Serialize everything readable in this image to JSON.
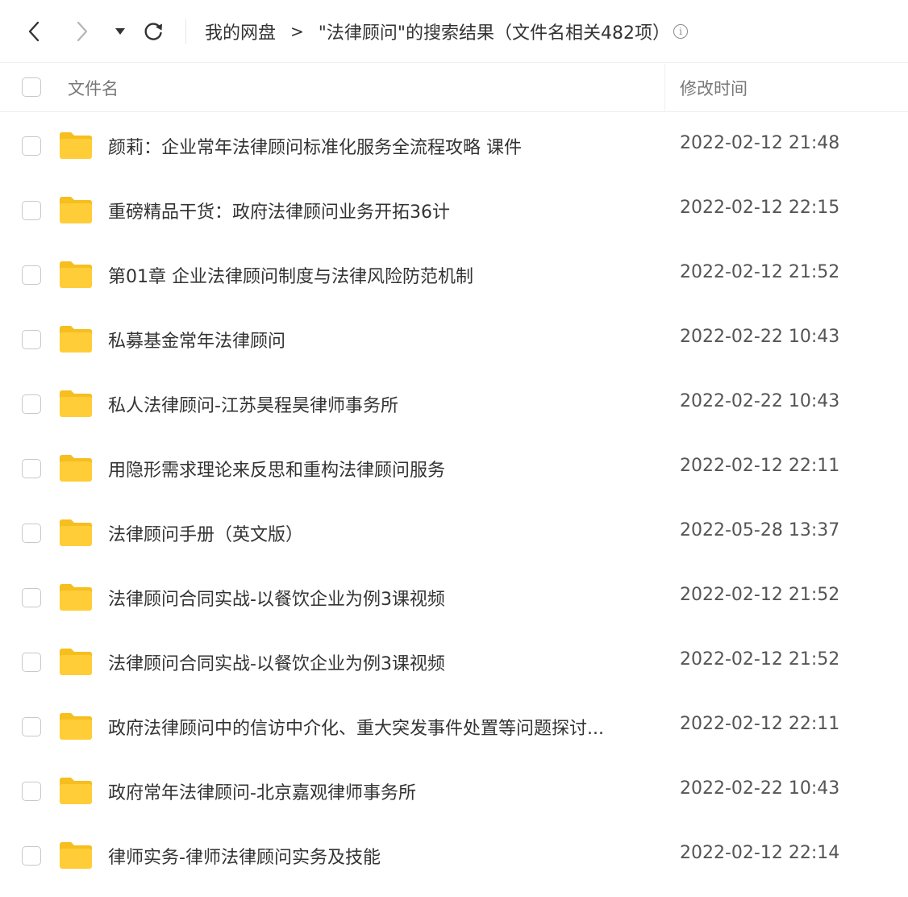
{
  "colors": {
    "folder": "#FFCD38",
    "folder_tab": "#F6BE1E",
    "text": "#333333",
    "muted": "#777777",
    "border": "#eeeeee"
  },
  "nav": {
    "back_icon": "chevron-left-icon",
    "forward_icon": "chevron-right-icon",
    "history_icon": "caret-down-icon",
    "refresh_icon": "refresh-icon"
  },
  "breadcrumb": {
    "root": "我的网盘",
    "separator": ">",
    "current": "\"法律顾问\"的搜索结果（文件名相关482项）",
    "info_icon": "info-icon",
    "info_glyph": "i"
  },
  "table": {
    "columns": {
      "name": "文件名",
      "modified": "修改时间"
    },
    "rows": [
      {
        "name": "颜莉：企业常年法律顾问标准化服务全流程攻略 课件",
        "time": "2022-02-12 21:48"
      },
      {
        "name": "重磅精品干货：政府法律顾问业务开拓36计",
        "time": "2022-02-12 22:15"
      },
      {
        "name": "第01章 企业法律顾问制度与法律风险防范机制",
        "time": "2022-02-12 21:52"
      },
      {
        "name": "私募基金常年法律顾问",
        "time": "2022-02-22 10:43"
      },
      {
        "name": "私人法律顾问-江苏昊程昊律师事务所",
        "time": "2022-02-22 10:43"
      },
      {
        "name": "用隐形需求理论来反思和重构法律顾问服务",
        "time": "2022-02-12 22:11"
      },
      {
        "name": "法律顾问手册（英文版）",
        "time": "2022-05-28 13:37"
      },
      {
        "name": "法律顾问合同实战-以餐饮企业为例3课视频",
        "time": "2022-02-12 21:52"
      },
      {
        "name": "法律顾问合同实战-以餐饮企业为例3课视频",
        "time": "2022-02-12 21:52"
      },
      {
        "name": "政府法律顾问中的信访中介化、重大突发事件处置等问题探讨...",
        "time": "2022-02-12 22:11"
      },
      {
        "name": "政府常年法律顾问-北京嘉观律师事务所",
        "time": "2022-02-22 10:43"
      },
      {
        "name": "律师实务-律师法律顾问实务及技能",
        "time": "2022-02-12 22:14"
      }
    ]
  }
}
